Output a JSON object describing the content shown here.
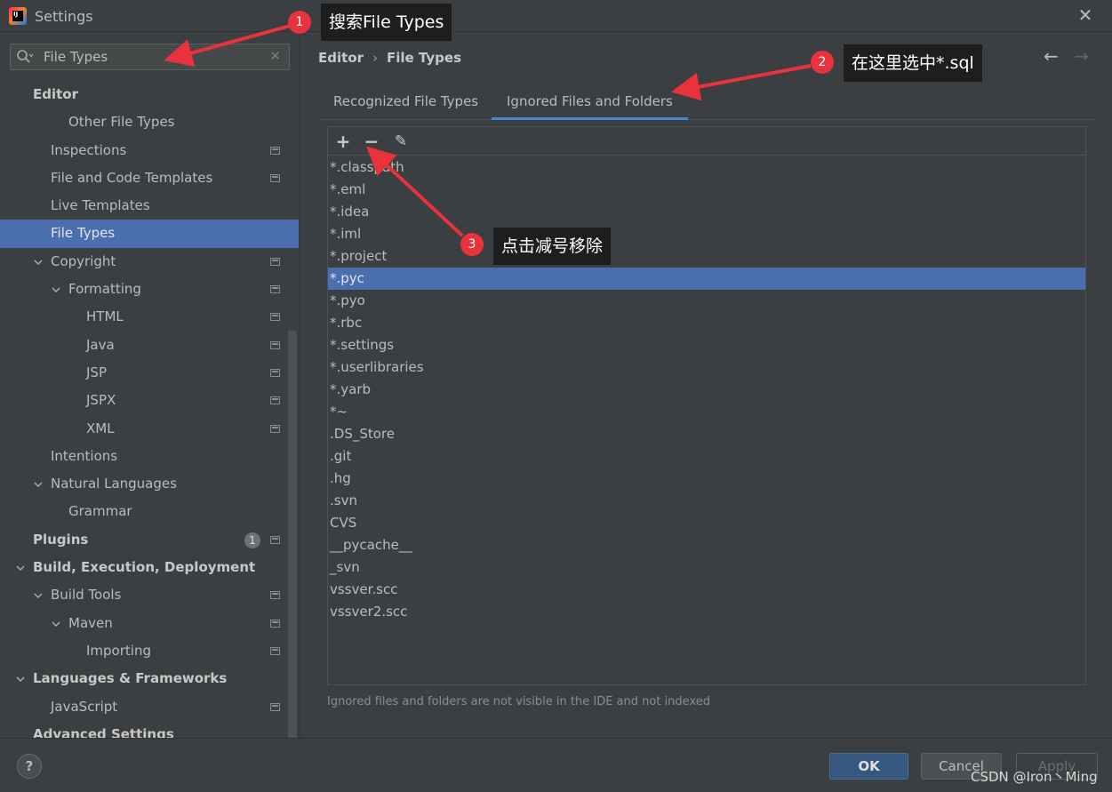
{
  "window": {
    "title": "Settings",
    "icon": "intellij-icon",
    "icon_text": "IJ",
    "close_icon": "close-icon"
  },
  "search": {
    "value": "File Types"
  },
  "tree": {
    "items": [
      {
        "label": "Editor",
        "level": 0,
        "bold": true,
        "expand": "none",
        "proj": false
      },
      {
        "label": "Other File Types",
        "level": 2,
        "bold": false,
        "expand": "none",
        "proj": false
      },
      {
        "label": "Inspections",
        "level": 1,
        "bold": false,
        "expand": "none",
        "proj": true
      },
      {
        "label": "File and Code Templates",
        "level": 1,
        "bold": false,
        "expand": "none",
        "proj": true
      },
      {
        "label": "Live Templates",
        "level": 1,
        "bold": false,
        "expand": "none",
        "proj": false
      },
      {
        "label": "File Types",
        "level": 1,
        "bold": false,
        "expand": "none",
        "proj": false,
        "selected": true
      },
      {
        "label": "Copyright",
        "level": 1,
        "bold": false,
        "expand": "open",
        "proj": true
      },
      {
        "label": "Formatting",
        "level": 2,
        "bold": false,
        "expand": "open",
        "proj": true
      },
      {
        "label": "HTML",
        "level": 3,
        "bold": false,
        "expand": "none",
        "proj": true
      },
      {
        "label": "Java",
        "level": 3,
        "bold": false,
        "expand": "none",
        "proj": true
      },
      {
        "label": "JSP",
        "level": 3,
        "bold": false,
        "expand": "none",
        "proj": true
      },
      {
        "label": "JSPX",
        "level": 3,
        "bold": false,
        "expand": "none",
        "proj": true
      },
      {
        "label": "XML",
        "level": 3,
        "bold": false,
        "expand": "none",
        "proj": true
      },
      {
        "label": "Intentions",
        "level": 1,
        "bold": false,
        "expand": "none",
        "proj": false
      },
      {
        "label": "Natural Languages",
        "level": 1,
        "bold": false,
        "expand": "open",
        "proj": false
      },
      {
        "label": "Grammar",
        "level": 2,
        "bold": false,
        "expand": "none",
        "proj": false
      },
      {
        "label": "Plugins",
        "level": 0,
        "bold": true,
        "expand": "none",
        "proj": true,
        "badge": "1"
      },
      {
        "label": "Build, Execution, Deployment",
        "level": 0,
        "bold": true,
        "expand": "open",
        "proj": false
      },
      {
        "label": "Build Tools",
        "level": 1,
        "bold": false,
        "expand": "open",
        "proj": true
      },
      {
        "label": "Maven",
        "level": 2,
        "bold": false,
        "expand": "open",
        "proj": true
      },
      {
        "label": "Importing",
        "level": 3,
        "bold": false,
        "expand": "none",
        "proj": true
      },
      {
        "label": "Languages & Frameworks",
        "level": 0,
        "bold": true,
        "expand": "open",
        "proj": false
      },
      {
        "label": "JavaScript",
        "level": 1,
        "bold": false,
        "expand": "none",
        "proj": true
      },
      {
        "label": "Advanced Settings",
        "level": 0,
        "bold": true,
        "expand": "none",
        "proj": false
      }
    ]
  },
  "breadcrumb": {
    "parent": "Editor",
    "sep": "›",
    "current": "File Types"
  },
  "tabs": [
    {
      "label": "Recognized File Types",
      "active": false
    },
    {
      "label": "Ignored Files and Folders",
      "active": true
    }
  ],
  "toolbar": {
    "add": "+",
    "remove": "−",
    "edit": "✎"
  },
  "ignored_list": [
    "*.classpath",
    "*.eml",
    "*.idea",
    "*.iml",
    "*.project",
    "*.pyc",
    "*.pyo",
    "*.rbc",
    "*.settings",
    "*.userlibraries",
    "*.yarb",
    "*~",
    ".DS_Store",
    ".git",
    ".hg",
    ".svn",
    "CVS",
    "__pycache__",
    "_svn",
    "vssver.scc",
    "vssver2.scc"
  ],
  "selected_item": "*.pyc",
  "hint": "Ignored files and folders are not visible in the IDE and not indexed",
  "buttons": {
    "ok": "OK",
    "cancel": "Cancel",
    "apply": "Apply",
    "help": "?"
  },
  "watermark": "CSDN @Iron丶Ming",
  "annotations": [
    {
      "num": "1",
      "text": "搜索File Types"
    },
    {
      "num": "2",
      "text": "在这里选中*.sql"
    },
    {
      "num": "3",
      "text": "点击减号移除"
    }
  ],
  "colors": {
    "selection": "#4b6eaf",
    "accent": "#4a88c7",
    "annotation": "#e8323c"
  }
}
